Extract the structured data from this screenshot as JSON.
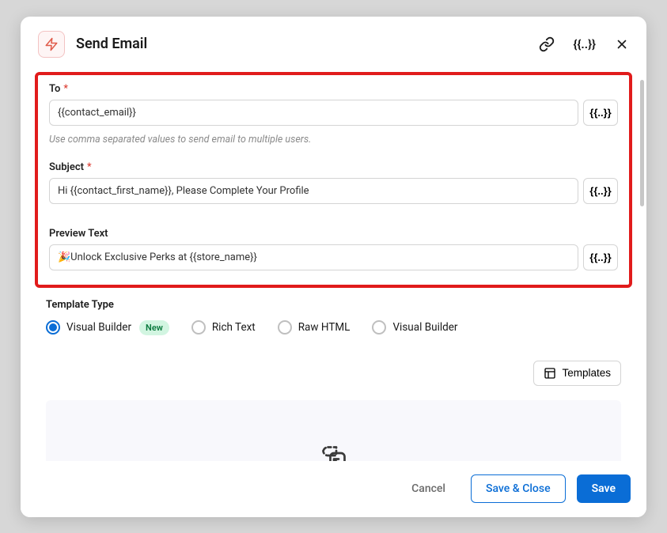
{
  "header": {
    "title": "Send Email"
  },
  "fields": {
    "to": {
      "label": "To",
      "value": "{{contact_email}}",
      "help": "Use comma separated values to send email to multiple users."
    },
    "subject": {
      "label": "Subject",
      "value": "Hi {{contact_first_name}}, Please Complete Your Profile"
    },
    "preview": {
      "label": "Preview Text",
      "value": "🎉Unlock Exclusive Perks at {{store_name}}"
    }
  },
  "token_glyph": "{{..}}",
  "template_type": {
    "label": "Template Type",
    "options": {
      "visual_builder_new": "Visual Builder",
      "new_badge": "New",
      "rich_text": "Rich Text",
      "raw_html": "Raw HTML",
      "visual_builder": "Visual Builder"
    }
  },
  "templates_button": "Templates",
  "footer": {
    "cancel": "Cancel",
    "save_close": "Save & Close",
    "save": "Save"
  }
}
